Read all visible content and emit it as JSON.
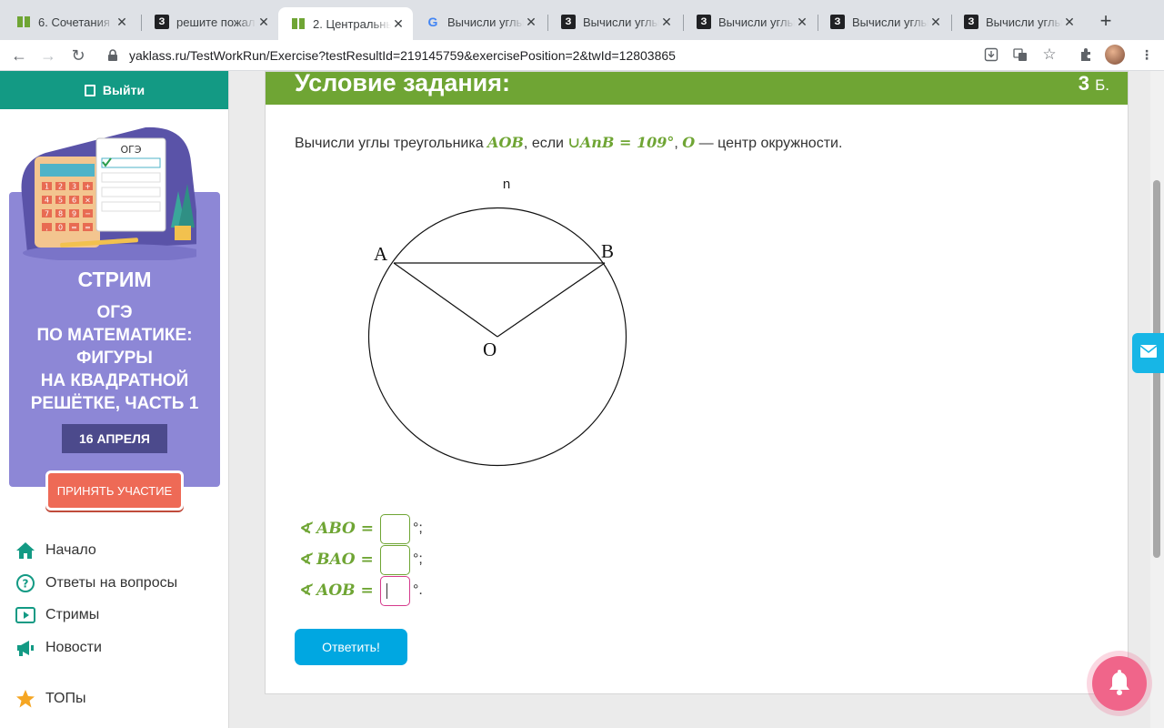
{
  "browser": {
    "tabs": [
      {
        "title": "6. Сочетания и",
        "icon": "yaklass-icon",
        "active": false
      },
      {
        "title": "решите пожал",
        "icon": "znanija-icon",
        "active": false
      },
      {
        "title": "2. Центральнь",
        "icon": "yaklass-icon",
        "active": true
      },
      {
        "title": "Вычисли углы",
        "icon": "google-icon",
        "active": false
      },
      {
        "title": "Вычисли углы",
        "icon": "znanija-icon",
        "active": false
      },
      {
        "title": "Вычисли углы",
        "icon": "znanija-icon",
        "active": false
      },
      {
        "title": "Вычисли углы",
        "icon": "znanija-icon",
        "active": false
      },
      {
        "title": "Вычисли углы",
        "icon": "znanija-icon",
        "active": false
      }
    ],
    "url": "yaklass.ru/TestWorkRun/Exercise?testResultId=219145759&exercisePosition=2&twId=12803865"
  },
  "sidebar": {
    "logout_label": "Выйти",
    "promo": {
      "card_label": "ОГЭ",
      "calc_keys": [
        "1",
        "2",
        "3",
        "+",
        "4",
        "5",
        "6",
        "×",
        "7",
        "8",
        "9",
        "−",
        ",",
        "0",
        "=",
        "="
      ],
      "title": "СТРИМ",
      "subtitle": "ОГЭ\nПО МАТЕМАТИКЕ:\nФИГУРЫ\nНА КВАДРАТНОЙ\nРЕШЁТКЕ, ЧАСТЬ 1",
      "date": "16 АПРЕЛЯ",
      "button": "ПРИНЯТЬ УЧАСТИЕ"
    },
    "nav": [
      {
        "label": "Начало",
        "icon": "home-icon"
      },
      {
        "label": "Ответы на вопросы",
        "icon": "question-icon"
      },
      {
        "label": "Стримы",
        "icon": "play-icon"
      },
      {
        "label": "Новости",
        "icon": "megaphone-icon"
      },
      {
        "label": "ТОПы",
        "icon": "star-icon"
      }
    ]
  },
  "task": {
    "header_title": "Условие задания:",
    "points_value": "3",
    "points_unit": "Б.",
    "text_1": "Вычисли углы треугольника ",
    "math_aob": "AOB",
    "text_2": ", если ",
    "math_arc": "∪AnB = 109°",
    "text_3": ", ",
    "math_o": "O",
    "text_4": " — центр окружности.",
    "diagram": {
      "label_n": "n",
      "label_a": "A",
      "label_b": "B",
      "label_o": "O"
    },
    "answers": [
      {
        "label": "∢ ABO =",
        "suffix": "°;",
        "focused": false
      },
      {
        "label": "∢ BAO =",
        "suffix": "°;",
        "focused": false
      },
      {
        "label": "∢ AOB =",
        "suffix": "°.",
        "focused": true
      }
    ],
    "submit_label": "Ответить!"
  },
  "colors": {
    "green": "#6fa534",
    "teal": "#139a84",
    "blue": "#00a7e1",
    "pink": "#f0658a"
  }
}
